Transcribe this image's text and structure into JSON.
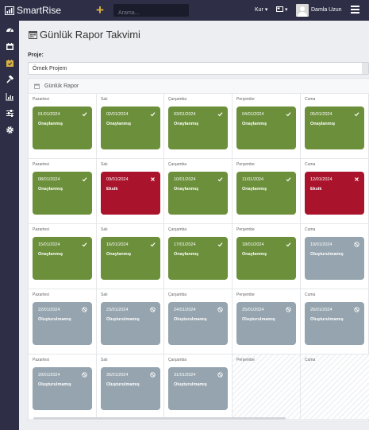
{
  "header": {
    "app_name": "SmartRise",
    "search_placeholder": "Arama...",
    "currency": "Kur",
    "user_name": "Damla Uzun",
    "add_icon": "plus-icon",
    "language_icon": "flag-icon",
    "menu_icon": "hamburger-icon"
  },
  "sidebar": {
    "items": [
      {
        "icon": "dashboard-icon",
        "active": false
      },
      {
        "icon": "calendar-icon",
        "active": false
      },
      {
        "icon": "calendar-check-icon",
        "active": true
      },
      {
        "icon": "hammer-icon",
        "active": false
      },
      {
        "icon": "chart-icon",
        "active": false
      },
      {
        "icon": "sliders-icon",
        "active": false
      },
      {
        "icon": "gear-icon",
        "active": false
      }
    ]
  },
  "page": {
    "title": "Günlük Rapor Takvimi",
    "project_label": "Proje:",
    "project_value": "Örnek Projem",
    "card_title": "Günlük Rapor"
  },
  "colors": {
    "approved": "#6b8f3a",
    "missing": "#a9142c",
    "not_created": "#95a4ae",
    "sidebar_bg": "#2e2f47",
    "accent": "#d9b13f"
  },
  "calendar": {
    "weeks": [
      [
        {
          "day": "Pazartesi",
          "date": "01/01/2024",
          "status": "Onaylanmış",
          "type": "approved"
        },
        {
          "day": "Salı",
          "date": "02/01/2024",
          "status": "Onaylanmış",
          "type": "approved"
        },
        {
          "day": "Çarşamba",
          "date": "03/01/2024",
          "status": "Onaylanmış",
          "type": "approved"
        },
        {
          "day": "Perşembe",
          "date": "04/01/2024",
          "status": "Onaylanmış",
          "type": "approved"
        },
        {
          "day": "Cuma",
          "date": "05/01/2024",
          "status": "Onaylanmış",
          "type": "approved"
        }
      ],
      [
        {
          "day": "Pazartesi",
          "date": "08/01/2024",
          "status": "Onaylanmış",
          "type": "approved"
        },
        {
          "day": "Salı",
          "date": "09/01/2024",
          "status": "Eksik",
          "type": "missing"
        },
        {
          "day": "Çarşamba",
          "date": "10/01/2024",
          "status": "Onaylanmış",
          "type": "approved"
        },
        {
          "day": "Perşembe",
          "date": "11/01/2024",
          "status": "Onaylanmış",
          "type": "approved"
        },
        {
          "day": "Cuma",
          "date": "12/01/2024",
          "status": "Eksik",
          "type": "missing"
        }
      ],
      [
        {
          "day": "Pazartesi",
          "date": "15/01/2024",
          "status": "Onaylanmış",
          "type": "approved"
        },
        {
          "day": "Salı",
          "date": "16/01/2024",
          "status": "Onaylanmış",
          "type": "approved"
        },
        {
          "day": "Çarşamba",
          "date": "17/01/2024",
          "status": "Onaylanmış",
          "type": "approved"
        },
        {
          "day": "Perşembe",
          "date": "18/01/2024",
          "status": "Onaylanmış",
          "type": "approved"
        },
        {
          "day": "Cuma",
          "date": "19/01/2024",
          "status": "Oluşturulmamış",
          "type": "not_created"
        }
      ],
      [
        {
          "day": "Pazartesi",
          "date": "22/01/2024",
          "status": "Oluşturulmamış",
          "type": "not_created"
        },
        {
          "day": "Salı",
          "date": "23/01/2024",
          "status": "Oluşturulmamış",
          "type": "not_created"
        },
        {
          "day": "Çarşamba",
          "date": "24/01/2024",
          "status": "Oluşturulmamış",
          "type": "not_created"
        },
        {
          "day": "Perşembe",
          "date": "25/01/2024",
          "status": "Oluşturulmamış",
          "type": "not_created"
        },
        {
          "day": "Cuma",
          "date": "26/01/2024",
          "status": "Oluşturulmamış",
          "type": "not_created"
        }
      ],
      [
        {
          "day": "Pazartesi",
          "date": "29/01/2024",
          "status": "Oluşturulmamış",
          "type": "not_created"
        },
        {
          "day": "Salı",
          "date": "30/01/2024",
          "status": "Oluşturulmamış",
          "type": "not_created"
        },
        {
          "day": "Çarşamba",
          "date": "31/01/2024",
          "status": "Oluşturulmamış",
          "type": "not_created"
        },
        {
          "day": "Perşembe",
          "date": "",
          "status": "",
          "type": "empty"
        },
        {
          "day": "Cuma",
          "date": "",
          "status": "",
          "type": "empty"
        }
      ]
    ]
  }
}
